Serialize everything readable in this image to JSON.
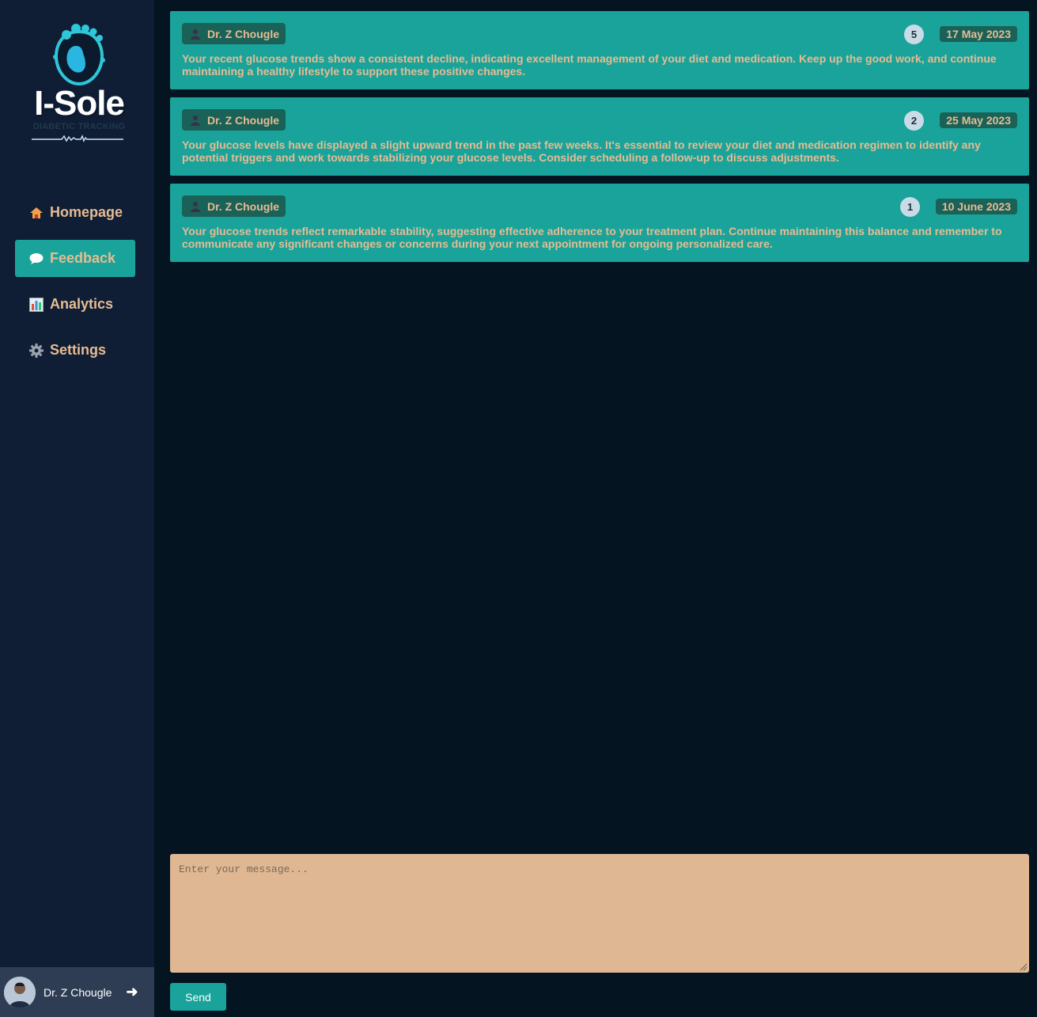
{
  "brand": {
    "name": "I-Sole",
    "tagline": "DIABETIC TRACKING"
  },
  "nav": {
    "items": [
      {
        "label": "Homepage",
        "icon": "house-icon"
      },
      {
        "label": "Feedback",
        "icon": "speech-bubble-icon",
        "active": true
      },
      {
        "label": "Analytics",
        "icon": "bar-chart-icon"
      },
      {
        "label": "Settings",
        "icon": "gear-icon"
      }
    ]
  },
  "user": {
    "name": "Dr. Z Chougle",
    "logout_glyph": "➜"
  },
  "feedback": [
    {
      "author": "Dr. Z Chougle",
      "rating": "5",
      "date": "17 May 2023",
      "message": "Your recent glucose trends show a consistent decline, indicating excellent management of your diet and medication. Keep up the good work, and continue maintaining a healthy lifestyle to support these positive changes."
    },
    {
      "author": "Dr. Z Chougle",
      "rating": "2",
      "date": "25 May 2023",
      "message": "Your glucose levels have displayed a slight upward trend in the past few weeks. It's essential to review your diet and medication regimen to identify any potential triggers and work towards stabilizing your glucose levels. Consider scheduling a follow-up to discuss adjustments."
    },
    {
      "author": "Dr. Z Chougle",
      "rating": "1",
      "date": "10 June 2023",
      "message": "Your glucose trends reflect remarkable stability, suggesting effective adherence to your treatment plan. Continue maintaining this balance and remember to communicate any significant changes or concerns during your next appointment for ongoing personalized care."
    }
  ],
  "composer": {
    "placeholder": "Enter your message...",
    "send_label": "Send"
  },
  "colors": {
    "accent": "#1aa39a",
    "text_warm": "#e6bc92",
    "sidebar_bg": "#0f1d35",
    "page_bg": "#041421"
  }
}
